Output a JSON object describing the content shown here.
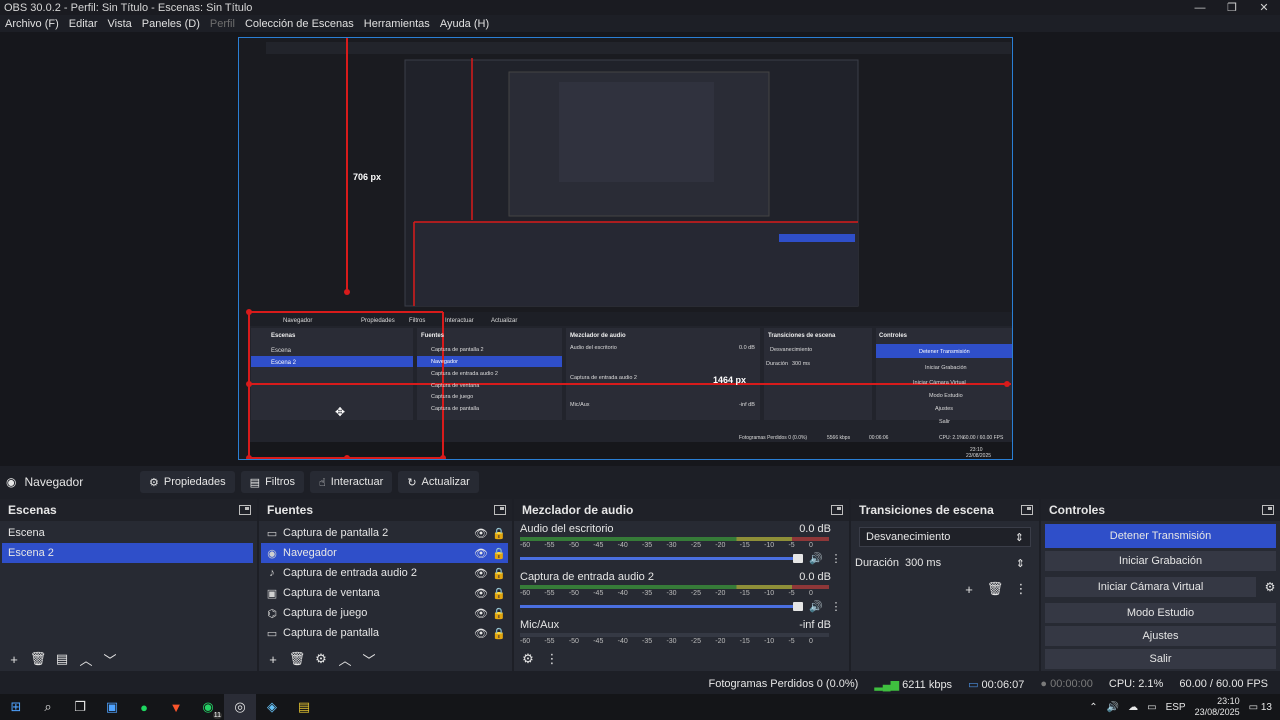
{
  "window": {
    "title": "OBS 30.0.2 - Perfil: Sin Título - Escenas: Sin Título",
    "min": "—",
    "max": "❐",
    "close": "✕"
  },
  "menu": [
    {
      "label": "Archivo (F)",
      "disabled": false
    },
    {
      "label": "Editar",
      "disabled": false
    },
    {
      "label": "Vista",
      "disabled": false
    },
    {
      "label": "Paneles (D)",
      "disabled": false
    },
    {
      "label": "Perfil",
      "disabled": true
    },
    {
      "label": "Colección de Escenas",
      "disabled": false
    },
    {
      "label": "Herramientas",
      "disabled": false
    },
    {
      "label": "Ayuda (H)",
      "disabled": false
    }
  ],
  "preview": {
    "measure_vertical": "706 px",
    "measure_horizontal": "1464 px",
    "inner_labels": {
      "source": "Navegador",
      "properties": "Propiedades",
      "filters": "Filtros",
      "interact": "Interactuar",
      "refresh": "Actualizar",
      "scenes_title": "Escenas",
      "sources_title": "Fuentes",
      "mixer_title": "Mezclador de audio",
      "transitions_title": "Transiciones de escena",
      "controls_title": "Controles",
      "scenes": [
        "Escena",
        "Escena 2"
      ],
      "sources": [
        "Captura de pantalla 2",
        "Navegador",
        "Captura de entrada audio 2",
        "Captura de ventana",
        "Captura de juego",
        "Captura de pantalla"
      ],
      "ch1": "Audio del escritorio",
      "ch1_db": "0.0 dB",
      "ch2": "Captura de entrada audio 2",
      "ch3": "Mic/Aux",
      "ch3_db": "-inf dB",
      "transition": "Desvanecimiento",
      "duration_label": "Duración",
      "duration": "300 ms",
      "controls": [
        "Detener Transmisión",
        "Iniciar Grabación",
        "Iniciar Cámara Virtual",
        "Modo Estudio",
        "Ajustes",
        "Salir"
      ],
      "status": "Fotogramas Perdidos 0 (0.0%)",
      "kbps": "5566 kbps",
      "time": "00:06:06",
      "cpu": "CPU: 2.1%",
      "fps": "60.00 / 60.00 FPS",
      "clock": "23:10",
      "date": "23/08/2025"
    }
  },
  "context": {
    "source_name": "Navegador",
    "properties": "Propiedades",
    "filters": "Filtros",
    "interact": "Interactuar",
    "refresh": "Actualizar"
  },
  "scenes": {
    "title": "Escenas",
    "items": [
      {
        "label": "Escena",
        "selected": false
      },
      {
        "label": "Escena 2",
        "selected": true
      }
    ]
  },
  "sources": {
    "title": "Fuentes",
    "items": [
      {
        "label": "Captura de pantalla 2",
        "icon": "monitor-icon",
        "glyph": "▭",
        "selected": false
      },
      {
        "label": "Navegador",
        "icon": "globe-icon",
        "glyph": "◉",
        "selected": true
      },
      {
        "label": "Captura de entrada audio 2",
        "icon": "microphone-icon",
        "glyph": "♪",
        "selected": false
      },
      {
        "label": "Captura de ventana",
        "icon": "window-icon",
        "glyph": "▣",
        "selected": false
      },
      {
        "label": "Captura de juego",
        "icon": "gamepad-icon",
        "glyph": "⌬",
        "selected": false
      },
      {
        "label": "Captura de pantalla",
        "icon": "monitor-icon",
        "glyph": "▭",
        "selected": false
      }
    ]
  },
  "mixer": {
    "title": "Mezclador de audio",
    "ticks": [
      "-60",
      "-55",
      "-50",
      "-45",
      "-40",
      "-35",
      "-30",
      "-25",
      "-20",
      "-15",
      "-10",
      "-5",
      "0"
    ],
    "channels": [
      {
        "name": "Audio del escritorio",
        "db": "0.0 dB",
        "volume": 1.0
      },
      {
        "name": "Captura de entrada audio 2",
        "db": "0.0 dB",
        "volume": 1.0
      },
      {
        "name": "Mic/Aux",
        "db": "-inf dB",
        "volume": 0
      }
    ]
  },
  "transitions": {
    "title": "Transiciones de escena",
    "selected": "Desvanecimiento",
    "duration_label": "Duración",
    "duration": "300 ms"
  },
  "controls": {
    "title": "Controles",
    "stop_stream": "Detener Transmisión",
    "start_recording": "Iniciar Grabación",
    "start_virtual_cam": "Iniciar Cámara Virtual",
    "studio_mode": "Modo Estudio",
    "settings": "Ajustes",
    "exit": "Salir"
  },
  "status": {
    "dropped_frames": "Fotogramas Perdidos 0 (0.0%)",
    "bitrate": "6211 kbps",
    "stream_time": "00:06:07",
    "rec_time": "00:00:00",
    "cpu": "CPU: 2.1%",
    "fps": "60.00 / 60.00 FPS"
  },
  "taskbar": {
    "lang": "ESP",
    "time": "23:10",
    "date": "23/08/2025",
    "notif_count": "13",
    "whatsapp_badge": "11"
  }
}
